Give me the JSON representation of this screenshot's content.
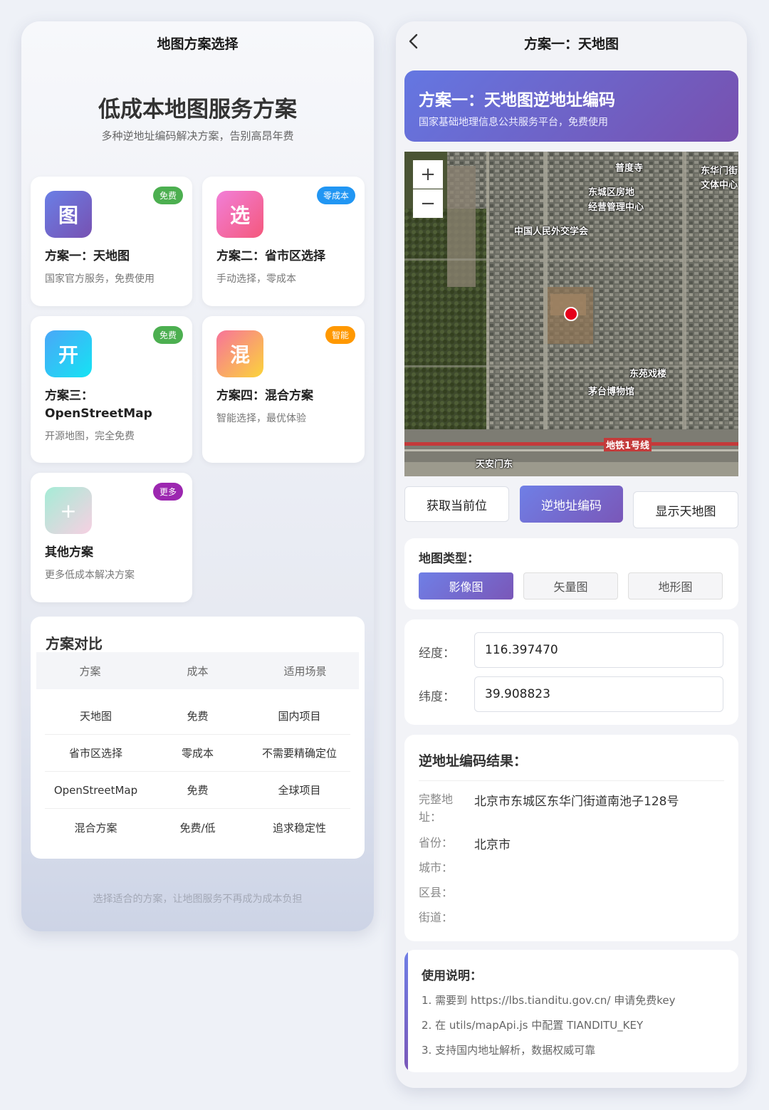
{
  "left": {
    "nav_title": "地图方案选择",
    "hero_title": "低成本地图服务方案",
    "hero_subtitle": "多种逆地址编码解决方案，告别高昂年费",
    "cards": [
      {
        "icon": "图",
        "badge": "免费",
        "title": "方案一：天地图",
        "desc": "国家官方服务，免费使用",
        "badge_color": "#4caf50"
      },
      {
        "icon": "选",
        "badge": "零成本",
        "title": "方案二：省市区选择",
        "desc": "手动选择，零成本",
        "badge_color": "#2196f3"
      },
      {
        "icon": "开",
        "badge": "免费",
        "title_line1": "方案三：",
        "title_line2": "OpenStreetMap",
        "desc": "开源地图，完全免费",
        "badge_color": "#4caf50"
      },
      {
        "icon": "混",
        "badge": "智能",
        "title": "方案四：混合方案",
        "desc": "智能选择，最优体验",
        "badge_color": "#ff9800"
      },
      {
        "icon": "+",
        "badge": "更多",
        "title": "其他方案",
        "desc": "更多低成本解决方案",
        "badge_color": "#9c27b0"
      }
    ],
    "comparison": {
      "title": "方案对比",
      "headers": [
        "方案",
        "成本",
        "适用场景"
      ],
      "rows": [
        [
          "天地图",
          "免费",
          "国内项目"
        ],
        [
          "省市区选择",
          "零成本",
          "不需要精确定位"
        ],
        [
          "OpenStreetMap",
          "免费",
          "全球项目"
        ],
        [
          "混合方案",
          "免费/低",
          "追求稳定性"
        ]
      ]
    },
    "footer": "选择适合的方案，让地图服务不再成为成本负担"
  },
  "right": {
    "nav_title": "方案一：天地图",
    "banner_title": "方案一：天地图逆地址编码",
    "banner_subtitle": "国家基础地理信息公共服务平台，免费使用",
    "map": {
      "zoom_in": "+",
      "zoom_out": "−",
      "labels": [
        "普度寺",
        "东城区房地",
        "经营管理中心",
        "东华门街",
        "文体中心",
        "中国人民外交学会",
        "东苑戏楼",
        "茅台博物馆",
        "地铁1号线",
        "天安门东"
      ]
    },
    "buttons": [
      "获取当前位",
      "逆地址编码",
      "显示天地图"
    ],
    "map_type": {
      "label": "地图类型：",
      "options": [
        "影像图",
        "矢量图",
        "地形图"
      ],
      "selected": "影像图"
    },
    "coords": {
      "lng_label": "经度：",
      "lng_value": "116.397470",
      "lat_label": "纬度：",
      "lat_value": "39.908823"
    },
    "result": {
      "title": "逆地址编码结果：",
      "full_label_1": "完整地",
      "full_label_2": "址：",
      "full_value": "北京市东城区东华门街道南池子128号",
      "province_label": "省份：",
      "province_value": "北京市",
      "city_label": "城市：",
      "district_label": "区县：",
      "street_label": "街道："
    },
    "usage": {
      "title": "使用说明：",
      "items": [
        "1. 需要到 https://lbs.tianditu.gov.cn/ 申请免费key",
        "2. 在 utils/mapApi.js 中配置 TIANDITU_KEY",
        "3. 支持国内地址解析，数据权威可靠"
      ]
    }
  }
}
